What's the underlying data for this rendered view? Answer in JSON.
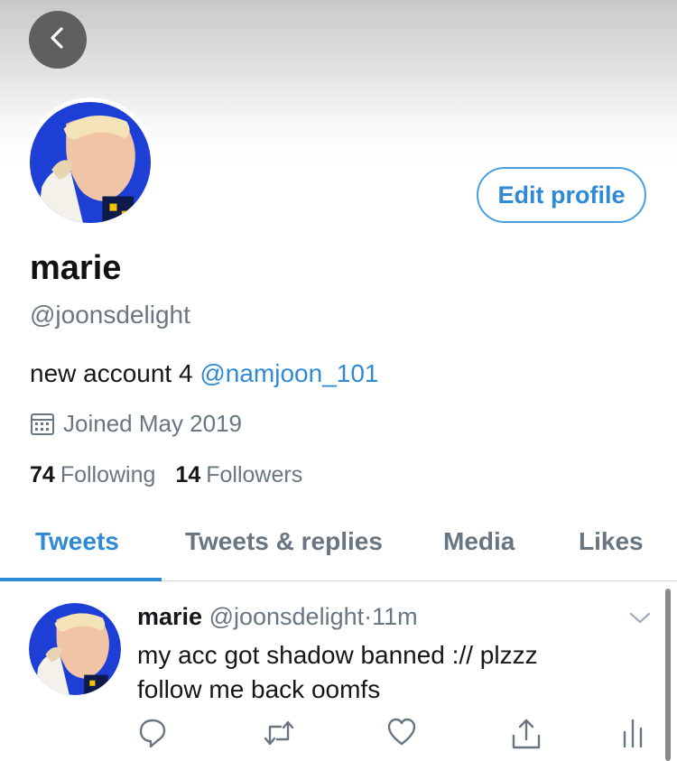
{
  "header": {
    "back_icon": "chevron-left-icon",
    "edit_profile_label": "Edit profile"
  },
  "profile": {
    "display_name": "marie",
    "handle": "@joonsdelight",
    "bio_text": "new account 4 ",
    "bio_mention": "@namjoon_101",
    "joined": "Joined May 2019",
    "following_count": "74",
    "following_label": "Following",
    "followers_count": "14",
    "followers_label": "Followers"
  },
  "tabs": [
    {
      "label": "Tweets",
      "active": true
    },
    {
      "label": "Tweets & replies",
      "active": false
    },
    {
      "label": "Media",
      "active": false
    },
    {
      "label": "Likes",
      "active": false
    }
  ],
  "tweet": {
    "name": "marie",
    "handle": "@joonsdelight",
    "separator": "·",
    "time": "11m",
    "text": "my acc got shadow banned :// plzzz follow me back oomfs",
    "actions": [
      "reply-icon",
      "retweet-icon",
      "like-icon",
      "share-icon",
      "analytics-icon"
    ]
  },
  "colors": {
    "accent": "#2f8ad6",
    "secondary_text": "#697782",
    "avatar_bg": "#1e3fd6"
  }
}
